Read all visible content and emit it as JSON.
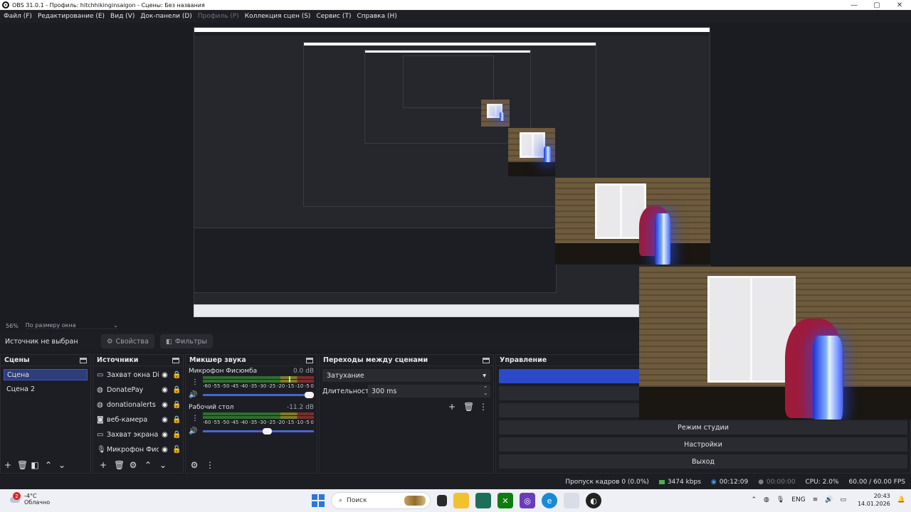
{
  "window": {
    "title": "OBS 31.0.1 - Профиль: hitchhikinginsaigon - Сцены: Без названия",
    "minimize": "—",
    "maximize": "▢",
    "close": "✕"
  },
  "menu": [
    {
      "label": "Файл (F)",
      "enabled": true
    },
    {
      "label": "Редактирование (E)",
      "enabled": true
    },
    {
      "label": "Вид (V)",
      "enabled": true
    },
    {
      "label": "Док-панели (D)",
      "enabled": true
    },
    {
      "label": "Профиль (P)",
      "enabled": false
    },
    {
      "label": "Коллекция сцен (S)",
      "enabled": true
    },
    {
      "label": "Сервис (T)",
      "enabled": true
    },
    {
      "label": "Справка (H)",
      "enabled": true
    }
  ],
  "preview": {
    "zoom": "56%",
    "scale_mode": "По размеру окна"
  },
  "source_bar": {
    "no_source": "Источник не выбран",
    "properties": "Свойства",
    "filters": "Фильтры"
  },
  "scenes": {
    "title": "Сцены",
    "items": [
      {
        "label": "Сцена",
        "active": true
      },
      {
        "label": "Сцена 2",
        "active": false
      }
    ]
  },
  "sources": {
    "title": "Источники",
    "items": [
      {
        "label": "Захват окна Disc",
        "icon": "window-capture-icon",
        "locked": true
      },
      {
        "label": "DonatePay",
        "icon": "browser-source-icon",
        "locked": true
      },
      {
        "label": "donationalerts",
        "icon": "browser-source-icon",
        "locked": true
      },
      {
        "label": "веб-камера",
        "icon": "camera-icon",
        "locked": true
      },
      {
        "label": "Захват экрана",
        "icon": "display-capture-icon",
        "locked": true
      },
      {
        "label": "Микрофон Фиск",
        "icon": "microphone-icon",
        "locked": false
      }
    ]
  },
  "mixer": {
    "title": "Микшер звука",
    "ticks": [
      "-60",
      "-55",
      "-50",
      "-45",
      "-40",
      "-35",
      "-30",
      "-25",
      "-20",
      "-15",
      "-10",
      "-5",
      "0"
    ],
    "channels": [
      {
        "name": "Микрофон Фисюмба",
        "db": "0.0 dB",
        "level": 0.78,
        "volume": 1.0
      },
      {
        "name": "Рабочий стол",
        "db": "-11.2 dB",
        "level": 0.0,
        "volume": 0.62
      }
    ]
  },
  "transitions": {
    "title": "Переходы между сценами",
    "selected": "Затухание",
    "duration_label": "Длительность",
    "duration_value": "300 ms"
  },
  "controls": {
    "title": "Управление",
    "studio_mode": "Режим студии",
    "settings": "Настройки",
    "exit": "Выход"
  },
  "status": {
    "dropped": "Пропуск кадров 0 (0.0%)",
    "bitrate": "3474 kbps",
    "stream_time": "00:12:09",
    "rec_time": "00:00:00",
    "cpu": "CPU: 2.0%",
    "fps": "60.00 / 60.00 FPS"
  },
  "taskbar": {
    "weather_badge": "2",
    "temperature": "-4°C",
    "condition": "Облачно",
    "search": "Поиск",
    "language": "ENG",
    "time": "20:43",
    "date": "14.01.2026"
  },
  "colors": {
    "accent": "#2c49c8",
    "panel": "#1d1e23",
    "background": "#1b1c22",
    "meter_green": "#2f6d2f",
    "status_stream": "#3aa0ff"
  }
}
